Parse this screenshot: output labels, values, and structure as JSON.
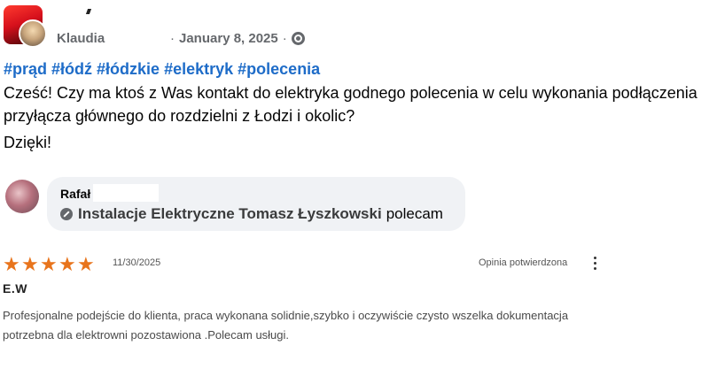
{
  "post": {
    "author": "Klaudia",
    "date": "January 8, 2025",
    "separator": "·",
    "hashtags": [
      "#prąd",
      "#łódź",
      "#łódzkie",
      "#elektryk",
      "#polecenia"
    ],
    "text": "Cześć! Czy ma ktoś z Was kontakt do elektryka godnego polecenia w celu wykonania podłączenia przyłącza głównego do rozdzielni z Łodzi i okolic?",
    "thanks": "Dzięki!"
  },
  "comment": {
    "author": "Rafał",
    "page_name": "Instalacje Elektryczne Tomasz Łyszkowski",
    "suffix": "polecam"
  },
  "review": {
    "rating": 5,
    "date": "11/30/2025",
    "verified_label": "Opinia potwierdzona",
    "reviewer": "E.W",
    "text": "Profesjonalne podejście do klienta, praca wykonana solidnie,szybko i oczywiście czysto wszelka dokumentacja potrzebna dla elektrowni pozostawiona .Polecam usługi.",
    "star_color": "#e8741c"
  },
  "colors": {
    "hashtag": "#1e6cc8",
    "meta": "#65686c",
    "bubble": "#f0f2f5"
  }
}
